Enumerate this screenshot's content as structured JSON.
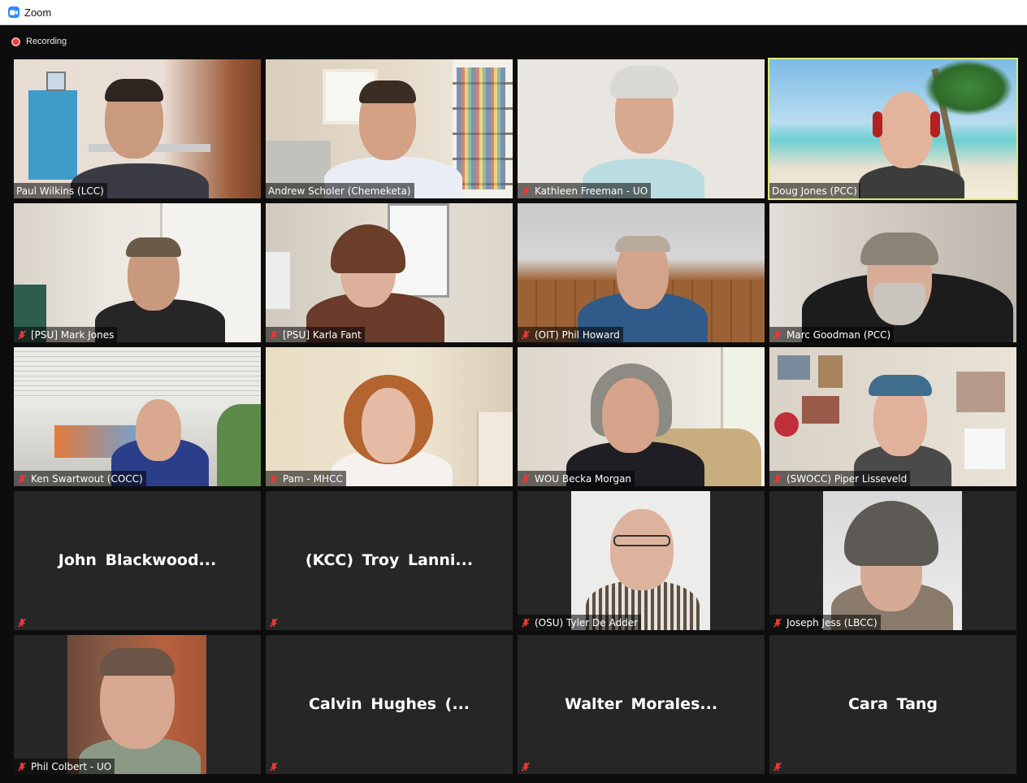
{
  "window": {
    "title": "Zoom",
    "accent": "#2d8cff"
  },
  "recording": {
    "label": "Recording",
    "color": "#e23b3b"
  },
  "meeting": {
    "active_speaker_color": "#d8ea7a",
    "participants": [
      {
        "name": "Paul Wilkins (LCC)",
        "muted": false,
        "video": true,
        "speaking": false
      },
      {
        "name": "Andrew Scholer (Chemeketa)",
        "muted": false,
        "video": true,
        "speaking": false
      },
      {
        "name": "Kathleen Freeman - UO",
        "muted": true,
        "video": true,
        "speaking": false
      },
      {
        "name": "Doug Jones (PCC)",
        "muted": false,
        "video": true,
        "speaking": true
      },
      {
        "name": "[PSU] Mark Jones",
        "muted": true,
        "video": true,
        "speaking": false
      },
      {
        "name": "[PSU] Karla Fant",
        "muted": true,
        "video": true,
        "speaking": false
      },
      {
        "name": "(OIT) Phil Howard",
        "muted": true,
        "video": true,
        "speaking": false
      },
      {
        "name": "Marc Goodman (PCC)",
        "muted": true,
        "video": true,
        "speaking": false
      },
      {
        "name": "Ken Swartwout (COCC)",
        "muted": true,
        "video": true,
        "speaking": false
      },
      {
        "name": "Pam - MHCC",
        "muted": true,
        "video": true,
        "speaking": false
      },
      {
        "name": "WOU Becka Morgan",
        "muted": true,
        "video": true,
        "speaking": false
      },
      {
        "name": "(SWOCC) Piper Lisseveld",
        "muted": true,
        "video": true,
        "speaking": false
      },
      {
        "name": "John Blackwood...",
        "muted": true,
        "video": false,
        "speaking": false
      },
      {
        "name": "(KCC) Troy Lanni...",
        "muted": true,
        "video": false,
        "speaking": false
      },
      {
        "name": "(OSU) Tyler De Adder",
        "muted": true,
        "video": true,
        "speaking": false
      },
      {
        "name": "Joseph Jess (LBCC)",
        "muted": true,
        "video": true,
        "speaking": false
      },
      {
        "name": "Phil Colbert - UO",
        "muted": true,
        "video": true,
        "speaking": false
      },
      {
        "name": "Calvin Hughes (...",
        "muted": true,
        "video": false,
        "speaking": false
      },
      {
        "name": "Walter Morales...",
        "muted": true,
        "video": false,
        "speaking": false
      },
      {
        "name": "Cara Tang",
        "muted": true,
        "video": false,
        "speaking": false
      }
    ]
  },
  "icons": {
    "app": "zoom-camera-icon",
    "recording": "record-dot-icon",
    "mute": "muted-microphone-icon"
  }
}
